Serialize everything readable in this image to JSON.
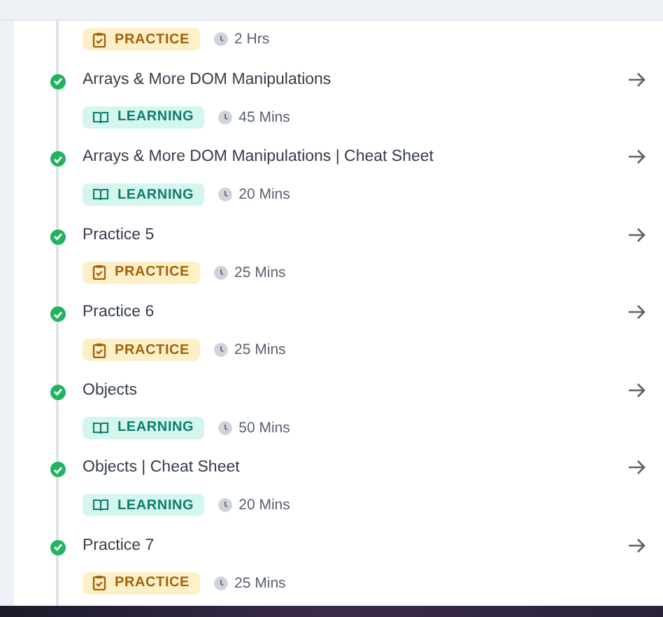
{
  "items": [
    {
      "kind": "practice",
      "tag": "PRACTICE",
      "duration": "2 Hrs"
    },
    {
      "kind": "learning",
      "title": "Arrays & More DOM Manipulations",
      "completed": true,
      "tag": "LEARNING",
      "duration": "45 Mins"
    },
    {
      "kind": "learning",
      "title": "Arrays & More DOM Manipulations | Cheat Sheet",
      "completed": true,
      "tag": "LEARNING",
      "duration": "20 Mins"
    },
    {
      "kind": "practice",
      "title": "Practice 5",
      "completed": true,
      "tag": "PRACTICE",
      "duration": "25 Mins"
    },
    {
      "kind": "practice",
      "title": "Practice 6",
      "completed": true,
      "tag": "PRACTICE",
      "duration": "25 Mins"
    },
    {
      "kind": "learning",
      "title": "Objects",
      "completed": true,
      "tag": "LEARNING",
      "duration": "50 Mins"
    },
    {
      "kind": "learning",
      "title": "Objects | Cheat Sheet",
      "completed": true,
      "tag": "LEARNING",
      "duration": "20 Mins"
    },
    {
      "kind": "practice",
      "title": "Practice 7",
      "completed": true,
      "tag": "PRACTICE",
      "duration": "25 Mins"
    }
  ]
}
